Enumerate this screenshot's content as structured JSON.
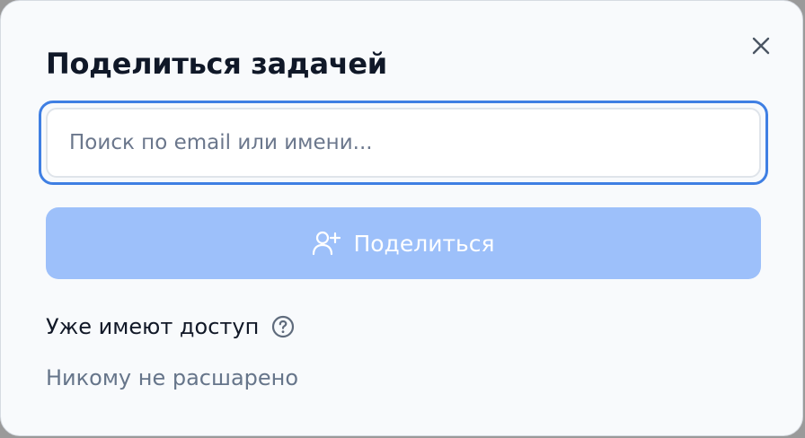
{
  "dialog": {
    "title": "Поделиться задачей",
    "close_icon": "close-icon"
  },
  "search": {
    "placeholder": "Поиск по email или имени...",
    "value": ""
  },
  "share_button": {
    "label": "Поделиться",
    "icon": "user-plus-icon",
    "state": "disabled"
  },
  "access": {
    "heading": "Уже имеют доступ",
    "help_icon": "question-circle-icon",
    "empty_text": "Никому не расшарено"
  },
  "colors": {
    "accent": "#3f7fe3",
    "button_disabled": "#9dc0fa",
    "title": "#101828",
    "muted": "#66758a",
    "background": "#f8fafc"
  }
}
